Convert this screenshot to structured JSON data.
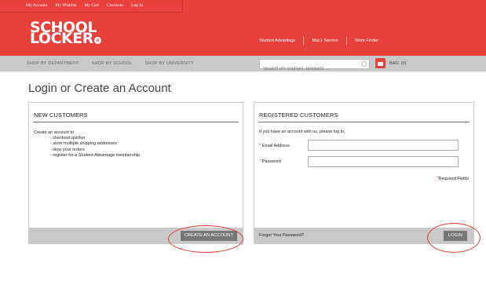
{
  "top_links": [
    "My Account",
    "My Wishlist",
    "My Cart",
    "Checkout",
    "Log In"
  ],
  "logo": {
    "line1": "SCHOOL",
    "line2": "LOCKER",
    "mark": "o"
  },
  "header_links": [
    "Student Advantage",
    "Mac1 Service",
    "Store Finder"
  ],
  "nav": {
    "items": [
      "SHOP BY DEPARTMENT",
      "SHOP BY SCHOOL",
      "SHOP BY UNIVERSITY"
    ],
    "search_placeholder": "Search uni courses, products ...",
    "bag_label": "BAG: (0)"
  },
  "page_title": "Login or Create an Account",
  "new_customers": {
    "heading": "NEW CUSTOMERS",
    "intro": "Create an account to:",
    "bullets": [
      "- checkout quicker",
      "- store multiple shipping addresses",
      "- view your orders",
      "- register for a Student Advantage membership"
    ],
    "button": "CREATE AN ACCOUNT"
  },
  "registered_customers": {
    "heading": "REGISTERED CUSTOMERS",
    "intro": "If you have an account with us, please log in.",
    "email_label": "Email Address",
    "password_label": "Password",
    "required_note": "Required Fields",
    "forgot": "Forgot Your Password?",
    "button": "LOGIN"
  },
  "colors": {
    "brand_red": "#e8413c",
    "nav_grey": "#c9c9c9",
    "button_grey": "#777777"
  }
}
